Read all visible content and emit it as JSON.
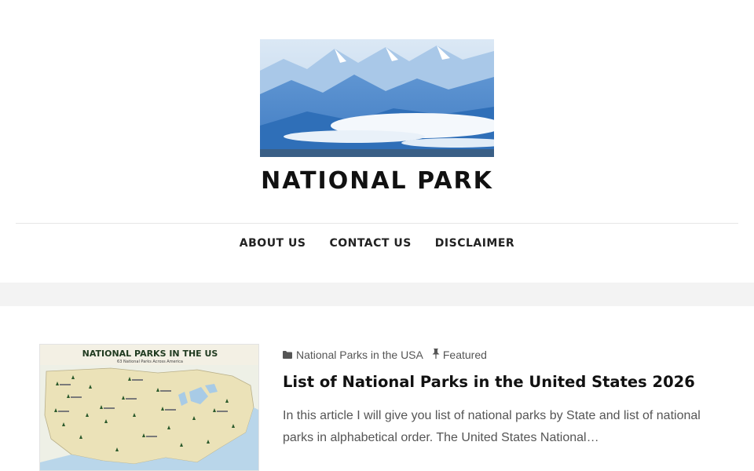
{
  "site": {
    "title": "NATIONAL PARK"
  },
  "nav": {
    "items": [
      {
        "label": "ABOUT US"
      },
      {
        "label": "CONTACT US"
      },
      {
        "label": "DISCLAIMER"
      }
    ]
  },
  "post": {
    "category": "National Parks in the USA",
    "featured_label": "Featured",
    "title": "List of National Parks in the United States 2026",
    "excerpt": "In this article I will give you list of national parks by State and list of national parks in alphabetical order. The United States National…",
    "thumbnail": {
      "heading": "NATIONAL PARKS IN THE US",
      "subheading": "63 National Parks Across America"
    }
  },
  "icons": {
    "category": "folder-icon",
    "featured": "pushpin-icon"
  },
  "colors": {
    "accent_text": "#111111",
    "meta_text": "#555555",
    "background": "#f3f3f3",
    "panel": "#ffffff"
  }
}
